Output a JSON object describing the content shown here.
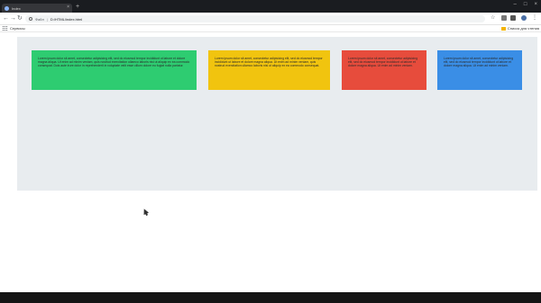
{
  "browser": {
    "tab_title": "Index",
    "tab_close": "×",
    "new_tab": "+",
    "window_controls": {
      "minimize": "–",
      "maximize": "□",
      "close": "×"
    },
    "nav": {
      "back": "←",
      "forward": "→",
      "reload": "↻"
    },
    "url_scheme": "Файл",
    "url_separator": "|",
    "url": "D:/HTML/index.html",
    "star": "☆",
    "menu": "⋮",
    "bookmarks_apps_label": "Сервисы",
    "bookmarks_other_label": "Список для чтения"
  },
  "cards": [
    {
      "color": "#2ecc71",
      "text": "Lorem ipsum dolor sit amet, consectetur adipisicing elit, sed do eiusmod tempor incididunt ut labore et dolore magna aliqua. Ut enim ad minim veniam, quis nostrud exercitation ullamco laboris nisi ut aliquip ex ea commodo consequat. Duis aute irure dolor in reprehenderit in voluptate velit esse cillum dolore eu fugiat nulla pariatur."
    },
    {
      "color": "#f1c40f",
      "text": "Lorem ipsum dolor sit amet, consectetur adipisicing elit, sed do eiusmod tempor incididunt ut labore et dolore magna aliqua. Ut enim ad minim veniam, quis nostrud exercitation ullamco laboris nisi ut aliquip ex ea commodo consequat."
    },
    {
      "color": "#e74c3c",
      "text": "Lorem ipsum dolor sit amet, consectetur adipisicing elit, sed do eiusmod tempor incididunt ut labore et dolore magna aliqua. Ut enim ad minim veniam."
    },
    {
      "color": "#3a8ee6",
      "text": "Lorem ipsum dolor sit amet, consectetur adipisicing elit, sed do eiusmod tempor incididunt ut labore et dolore magna aliqua. Ut enim ad minim veniam."
    }
  ],
  "colors": {
    "container_bg": "#e8ecef",
    "page_bg": "#ffffff"
  }
}
